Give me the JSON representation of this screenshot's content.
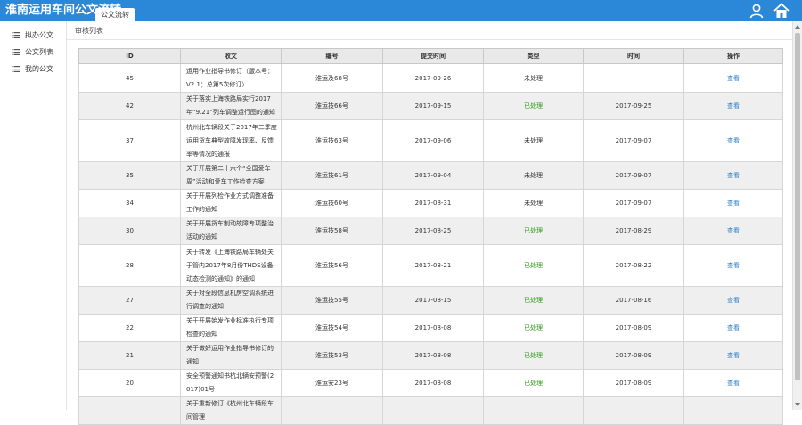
{
  "header": {
    "title": "淮南运用车间公文流转",
    "active_tab": "公文流转",
    "icons": [
      "user-icon",
      "home-icon"
    ]
  },
  "sidebar": {
    "items": [
      {
        "label": "拟办公文",
        "icon": "list-icon"
      },
      {
        "label": "公文列表",
        "icon": "list-icon"
      },
      {
        "label": "我的公文",
        "icon": "list-icon"
      }
    ]
  },
  "main": {
    "breadcrumb": "审核列表",
    "table": {
      "columns": [
        "ID",
        "收文",
        "编号",
        "提交时间",
        "类型",
        "时间",
        "操作"
      ],
      "rows": [
        {
          "id": "45",
          "doc": "运用作业指导书修订（版本号：V2.1；总第5次修订）",
          "code": "淮运及68号",
          "submit": "2017-09-26",
          "type": "未处理",
          "time": "",
          "action": "查看"
        },
        {
          "id": "42",
          "doc": "关于落实上海铁路局实行2017年“9.21”列车调整运行图的通知",
          "code": "淮运技66号",
          "submit": "2017-09-15",
          "type": "已处理",
          "time": "2017-09-25",
          "action": "查看"
        },
        {
          "id": "37",
          "doc": "杭州北车辆段关于2017年二季度运用货车典型故障发现率、反馈率等情况的通报",
          "code": "淮运技63号",
          "submit": "2017-09-06",
          "type": "未处理",
          "time": "2017-09-07",
          "action": "查看"
        },
        {
          "id": "35",
          "doc": "关于开展第二十六个“全国爱车周”活动和爱车工作检查方案",
          "code": "淮运技61号",
          "submit": "2017-09-04",
          "type": "未处理",
          "time": "2017-09-07",
          "action": "查看"
        },
        {
          "id": "34",
          "doc": "关于开展列检作业方式调整准备工作的通知",
          "code": "淮运技60号",
          "submit": "2017-08-31",
          "type": "未处理",
          "time": "2017-09-07",
          "action": "查看"
        },
        {
          "id": "30",
          "doc": "关于开展货车制动故障专项整治活动的通知",
          "code": "淮运技58号",
          "submit": "2017-08-25",
          "type": "已处理",
          "time": "2017-08-29",
          "action": "查看"
        },
        {
          "id": "28",
          "doc": "关于转发《上海铁路局车辆处关于管内2017年8月份THDS设备动态检测的通知》的通知",
          "code": "淮运技56号",
          "submit": "2017-08-21",
          "type": "已处理",
          "time": "2017-08-22",
          "action": "查看"
        },
        {
          "id": "27",
          "doc": "关于对全段信息机房空调系统进行调查的通知",
          "code": "淮运技55号",
          "submit": "2017-08-15",
          "type": "已处理",
          "time": "2017-08-16",
          "action": "查看"
        },
        {
          "id": "22",
          "doc": "关于开展始发作业标准执行专项检查的通知",
          "code": "淮运技54号",
          "submit": "2017-08-08",
          "type": "已处理",
          "time": "2017-08-09",
          "action": "查看"
        },
        {
          "id": "21",
          "doc": "关于做好运用作业指导书修订的通知",
          "code": "淮运技53号",
          "submit": "2017-08-08",
          "type": "已处理",
          "time": "2017-08-09",
          "action": "查看"
        },
        {
          "id": "20",
          "doc": "安全预警通知书杭北辆安预警(2017)01号",
          "code": "淮运安23号",
          "submit": "2017-08-08",
          "type": "已处理",
          "time": "2017-08-09",
          "action": "查看"
        },
        {
          "id": "",
          "doc": "关于重新修订《杭州北车辆段车间管理",
          "code": "",
          "submit": "",
          "type": "",
          "time": "",
          "action": ""
        }
      ]
    }
  },
  "colors": {
    "header_bg": "#2b88d8",
    "processed": "#2e9c1a",
    "link": "#2a7fc9"
  }
}
